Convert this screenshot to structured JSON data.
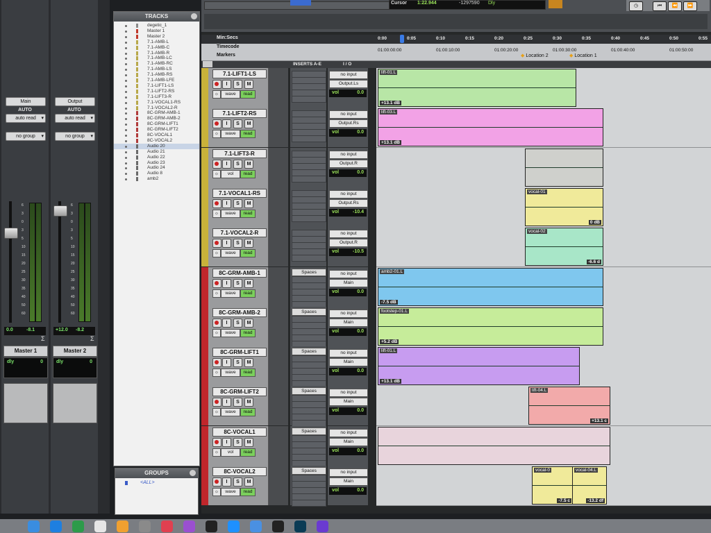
{
  "mix": {
    "strips": [
      {
        "io_label": "Main",
        "auto_label": "AUTO",
        "auto_mode": "auto read",
        "group": "no group",
        "vol": "0.0",
        "peak": "-8.1",
        "name": "Master 1",
        "delay_label": "dly",
        "delay_value": "0"
      },
      {
        "io_label": "Output",
        "auto_label": "AUTO",
        "auto_mode": "auto read",
        "group": "no group",
        "vol": "+12.0",
        "peak": "-8.2",
        "name": "Master 2",
        "delay_label": "dly",
        "delay_value": "0"
      }
    ],
    "scale": [
      "6",
      "3",
      "0",
      "3",
      "5",
      "10",
      "15",
      "20",
      "25",
      "30",
      "35",
      "40",
      "50",
      "60"
    ],
    "sum_icon": "sigma-icon"
  },
  "tracks_panel": {
    "title": "TRACKS",
    "items": [
      {
        "name": "degetic_1",
        "color": "#8a8a8a"
      },
      {
        "name": "Master 1",
        "color": "#c0392b"
      },
      {
        "name": "Master 2",
        "color": "#c0392b"
      },
      {
        "name": "7.1-AMB-L",
        "color": "#b8a84a"
      },
      {
        "name": "7.1-AMB-C",
        "color": "#b8a84a"
      },
      {
        "name": "7.1-AMB-R",
        "color": "#b8a84a"
      },
      {
        "name": "7.1-AMB-LC",
        "color": "#b8a84a"
      },
      {
        "name": "7.1-AMB-RC",
        "color": "#b8a84a"
      },
      {
        "name": "7.1-AMB-LS",
        "color": "#b8a84a"
      },
      {
        "name": "7.1-AMB-RS",
        "color": "#b8a84a"
      },
      {
        "name": "7.1-AMB-LFE",
        "color": "#b8a84a"
      },
      {
        "name": "7.1-LIFT1-LS",
        "color": "#b8a84a"
      },
      {
        "name": "7.1-LIFT2-RS",
        "color": "#b8a84a"
      },
      {
        "name": "7.1-LIFT3-R",
        "color": "#b8a84a"
      },
      {
        "name": "7.1-VOCAL1-RS",
        "color": "#b8a84a"
      },
      {
        "name": "7.1-VOCAL2-R",
        "color": "#b8a84a"
      },
      {
        "name": "8C-GRM-AMB-1",
        "color": "#b03a3a"
      },
      {
        "name": "8C-GRM-AMB-2",
        "color": "#b03a3a"
      },
      {
        "name": "8C-GRM-LIFT1",
        "color": "#b03a3a"
      },
      {
        "name": "8C-GRM-LIFT2",
        "color": "#b03a3a"
      },
      {
        "name": "8C-VOCAL1",
        "color": "#b03a3a"
      },
      {
        "name": "8C-VOCAL2",
        "color": "#b03a3a"
      },
      {
        "name": "Audio 20",
        "color": "#6a6a6a"
      },
      {
        "name": "Audio 21",
        "color": "#6a6a6a"
      },
      {
        "name": "Audio 22",
        "color": "#6a6a6a"
      },
      {
        "name": "Audio 23",
        "color": "#6a6a6a"
      },
      {
        "name": "Audio 24",
        "color": "#6a6a6a"
      },
      {
        "name": "Audio 8",
        "color": "#6a6a6a"
      },
      {
        "name": "amb2",
        "color": "#6a6a6a"
      }
    ],
    "selected": "Audio 20"
  },
  "groups_panel": {
    "title": "GROUPS",
    "item": "<ALL>"
  },
  "toolbar": {
    "cursor_label": "Cursor",
    "cursor_time": "1:22.944",
    "cursor_sample": "-1297590",
    "dly_label": "Dly"
  },
  "rulers": {
    "minsecs_label": "Min:Secs",
    "timecode_label": "Timecode",
    "markers_label": "Markers",
    "minsecs_ticks": [
      "0:00",
      "0:05",
      "0:10",
      "0:15",
      "0:20",
      "0:25",
      "0:30",
      "0:35",
      "0:40",
      "0:45",
      "0:50",
      "0:55"
    ],
    "timecode_ticks": [
      "01:00:00:00",
      "01:00:10:00",
      "01:00:20:00",
      "01:00:30:00",
      "01:00:40:00",
      "01:00:50:00"
    ],
    "markers": [
      "Location 2",
      "Location 1"
    ]
  },
  "columns": {
    "inserts": "INSERTS A-E",
    "io": "I / O"
  },
  "edit_tracks": [
    {
      "name": "7.1-LIFT1-LS",
      "color": "#c9b23a",
      "view": "wave",
      "auto": "read",
      "insert": "",
      "in": "no input",
      "out": "Output.Ls",
      "vol_label": "vol",
      "vol": "0.0",
      "clips": [
        {
          "label": "lift-01.L",
          "gain": "+13.1 dB",
          "color": "#b8e6a6"
        }
      ]
    },
    {
      "name": "7.1-LIFT2-RS",
      "color": "#c9b23a",
      "view": "wave",
      "auto": "read",
      "insert": "",
      "in": "no input",
      "out": "Output.Rs",
      "vol_label": "vol",
      "vol": "0.0",
      "clips": [
        {
          "label": "lift-03.L",
          "gain": "+13.1 dB",
          "color": "#f2a2e6"
        }
      ]
    },
    {
      "name": "7.1-LIFT3-R",
      "color": "#c9b23a",
      "view": "vol",
      "auto": "read",
      "insert": "",
      "in": "no input",
      "out": "Output.R",
      "vol_label": "vol",
      "vol": "0.0",
      "clips": [
        {
          "label": "",
          "gain": "",
          "color": "#cfd0cc"
        }
      ]
    },
    {
      "name": "7.1-VOCAL1-RS",
      "color": "#c9b23a",
      "view": "wave",
      "auto": "read",
      "insert": "",
      "in": "no input",
      "out": "Output.Rs",
      "vol_label": "vol",
      "vol": "-10.4",
      "clips": [
        {
          "label": "vocal-01",
          "gain": "0 dB",
          "color": "#f0ea9a"
        }
      ]
    },
    {
      "name": "7.1-VOCAL2-R",
      "color": "#c9b23a",
      "view": "wave",
      "auto": "read",
      "insert": "",
      "in": "no input",
      "out": "Output.R",
      "vol_label": "vol",
      "vol": "-10.5",
      "clips": [
        {
          "label": "vocal-02",
          "gain": "-6.6 d",
          "color": "#a8e6c8"
        }
      ]
    },
    {
      "name": "8C-GRM-AMB-1",
      "color": "#c0262b",
      "view": "wave",
      "auto": "read",
      "insert": "Spaces",
      "in": "no input",
      "out": "Main",
      "vol_label": "vol",
      "vol": "0.0",
      "clips": [
        {
          "label": "amb2-01.L",
          "gain": "-7.5 dB",
          "color": "#7fc7ee"
        }
      ]
    },
    {
      "name": "8C-GRM-AMB-2",
      "color": "#c0262b",
      "view": "wave",
      "auto": "read",
      "insert": "Spaces",
      "in": "no input",
      "out": "Main",
      "vol_label": "vol",
      "vol": "0.0",
      "clips": [
        {
          "label": "footstep-01.L",
          "gain": "+5.2 dB",
          "color": "#c6ec9a"
        }
      ]
    },
    {
      "name": "8C-GRM-LIFT1",
      "color": "#c0262b",
      "view": "wave",
      "auto": "read",
      "insert": "Spaces",
      "in": "no input",
      "out": "Main",
      "vol_label": "vol",
      "vol": "0.0",
      "clips": [
        {
          "label": "lift-01.L",
          "gain": "+13.1 dB",
          "color": "#c79cf0"
        }
      ]
    },
    {
      "name": "8C-GRM-LIFT2",
      "color": "#c0262b",
      "view": "wave",
      "auto": "read",
      "insert": "Spaces",
      "in": "no input",
      "out": "Main",
      "vol_label": "vol",
      "vol": "0.0",
      "clips": [
        {
          "label": "lift-04.L",
          "gain": "+13.1 c",
          "color": "#f2aaaa"
        }
      ]
    },
    {
      "name": "8C-VOCAL1",
      "color": "#c0262b",
      "view": "vol",
      "auto": "read",
      "insert": "Spaces",
      "in": "no input",
      "out": "Main",
      "vol_label": "vol",
      "vol": "0.0",
      "clips": [
        {
          "label": "",
          "gain": "",
          "color": "#e8d4dc"
        }
      ]
    },
    {
      "name": "8C-VOCAL2",
      "color": "#c0262b",
      "view": "wave",
      "auto": "read",
      "insert": "Spaces",
      "in": "no input",
      "out": "Main",
      "vol_label": "vol",
      "vol": "0.0",
      "clips": [
        {
          "label": "vocal-0",
          "gain": "-7.5 c",
          "color": "#f0ea9a"
        },
        {
          "label": "vocal-04.L",
          "gain": "-13.2 df",
          "color": "#f0ea9a"
        }
      ]
    }
  ],
  "clip_layout": [
    [
      [
        0.0,
        0.59
      ]
    ],
    [
      [
        0.0,
        0.67
      ]
    ],
    [
      [
        0.44,
        0.67
      ]
    ],
    [
      [
        0.44,
        0.67
      ]
    ],
    [
      [
        0.44,
        0.67
      ]
    ],
    [
      [
        0.0,
        0.67
      ]
    ],
    [
      [
        0.0,
        0.67
      ]
    ],
    [
      [
        0.0,
        0.6
      ]
    ],
    [
      [
        0.45,
        0.69
      ]
    ],
    [
      [
        0.0,
        0.69
      ]
    ],
    [
      [
        0.46,
        0.58
      ],
      [
        0.58,
        0.68
      ]
    ]
  ],
  "buttons": {
    "mute": "M",
    "solo": "S",
    "input": "I"
  },
  "dock_icons": [
    "finder-icon",
    "safari-icon",
    "chrome-icon",
    "calendar-icon",
    "photos-icon",
    "settings-icon",
    "music-icon",
    "podcasts-icon",
    "tv-icon",
    "appstore-icon",
    "mail-icon",
    "pro-tools-icon",
    "audition-icon",
    "app-icon"
  ]
}
